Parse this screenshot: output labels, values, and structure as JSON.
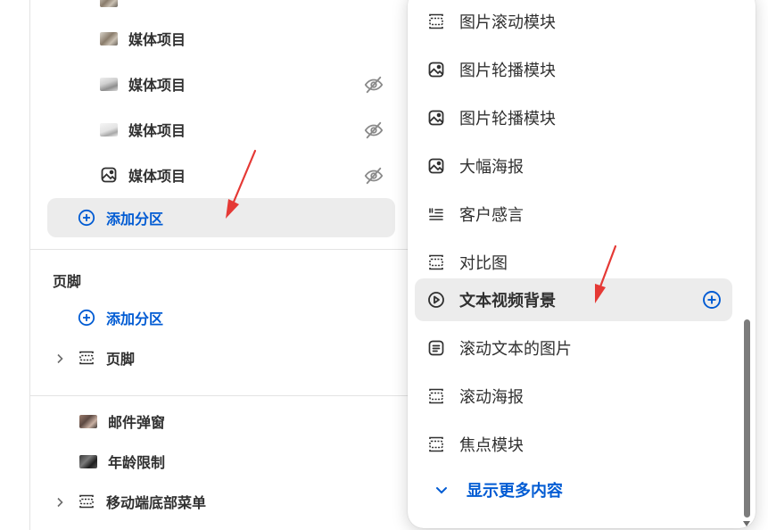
{
  "left": {
    "media_items": [
      {
        "label": "媒体项目",
        "hidden": false
      },
      {
        "label": "媒体项目",
        "hidden": true
      },
      {
        "label": "媒体项目",
        "hidden": true
      },
      {
        "label": "媒体项目",
        "hidden": true
      }
    ],
    "add_section_label": "添加分区",
    "footer": {
      "title": "页脚",
      "add_section_label": "添加分区",
      "group_label": "页脚"
    },
    "overlays": [
      {
        "label": "邮件弹窗"
      },
      {
        "label": "年龄限制"
      },
      {
        "label": "移动端底部菜单"
      }
    ]
  },
  "menu": {
    "items": [
      {
        "label": "图片滚动模块",
        "icon": "slideshow-icon"
      },
      {
        "label": "图片轮播模块",
        "icon": "image-icon"
      },
      {
        "label": "图片轮播模块",
        "icon": "image-icon"
      },
      {
        "label": "大幅海报",
        "icon": "image-icon"
      },
      {
        "label": "客户感言",
        "icon": "text-list-icon"
      },
      {
        "label": "对比图",
        "icon": "slideshow-icon"
      },
      {
        "label": "文本视频背景",
        "icon": "play-icon",
        "active": true
      },
      {
        "label": "滚动文本的图片",
        "icon": "text-block-icon"
      },
      {
        "label": "滚动海报",
        "icon": "slideshow-icon"
      },
      {
        "label": "焦点模块",
        "icon": "slideshow-icon"
      }
    ],
    "show_more_label": "显示更多内容"
  },
  "colors": {
    "accent": "#005bd3",
    "annotation_arrow": "#e53935",
    "highlight_bg": "#ececec"
  }
}
